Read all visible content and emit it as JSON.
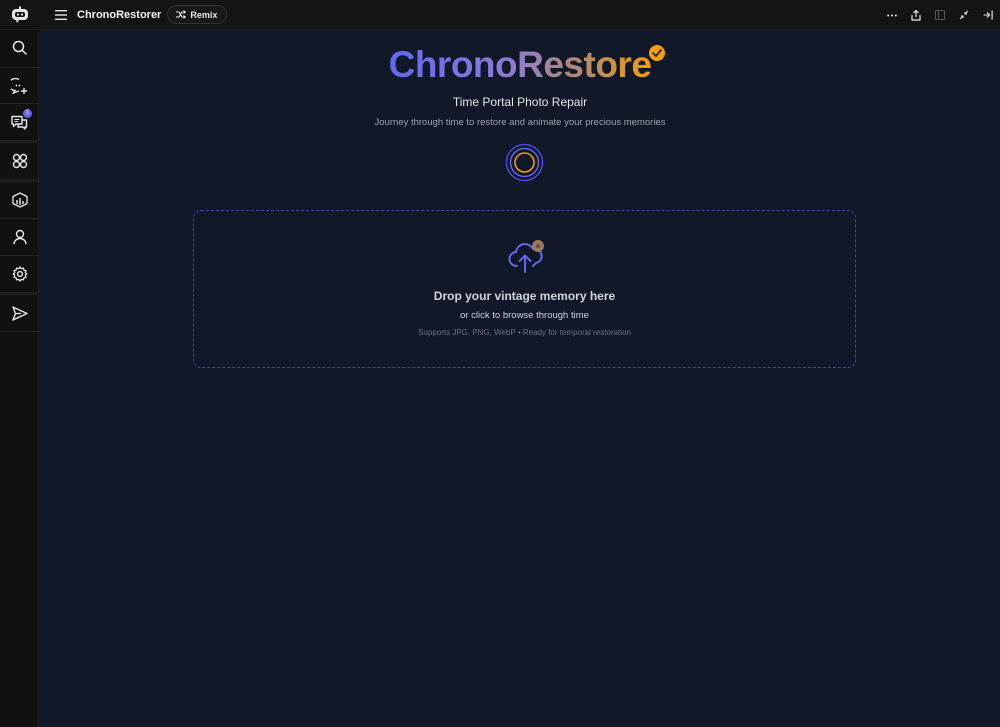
{
  "topbar": {
    "app_title": "ChronoRestorer",
    "remix_label": "Remix",
    "actions": [
      "more-icon",
      "share-icon",
      "panel-icon",
      "collapse-icon",
      "exit-icon"
    ]
  },
  "sidebar": {
    "items": [
      {
        "icon": "search-icon"
      },
      {
        "icon": "new-chat-icon"
      },
      {
        "icon": "chats-icon",
        "badge": "1"
      },
      {
        "icon": "apps-icon"
      },
      {
        "icon": "cube-chart-icon"
      },
      {
        "icon": "user-icon"
      },
      {
        "icon": "gear-icon"
      },
      {
        "icon": "send-icon"
      }
    ]
  },
  "hero": {
    "title": "ChronoRestore",
    "subtitle": "Time Portal Photo Repair",
    "tagline": "Journey through time to restore and animate your precious memories"
  },
  "upload": {
    "title": "Drop your vintage memory here",
    "subtitle": "or click to browse through time",
    "note": "Supports JPG, PNG, WebP • Ready for temporal restoration"
  },
  "colors": {
    "accent_indigo": "#6366f1",
    "accent_amber": "#f59e0b",
    "background": "#111827",
    "sidebar": "#111111"
  }
}
